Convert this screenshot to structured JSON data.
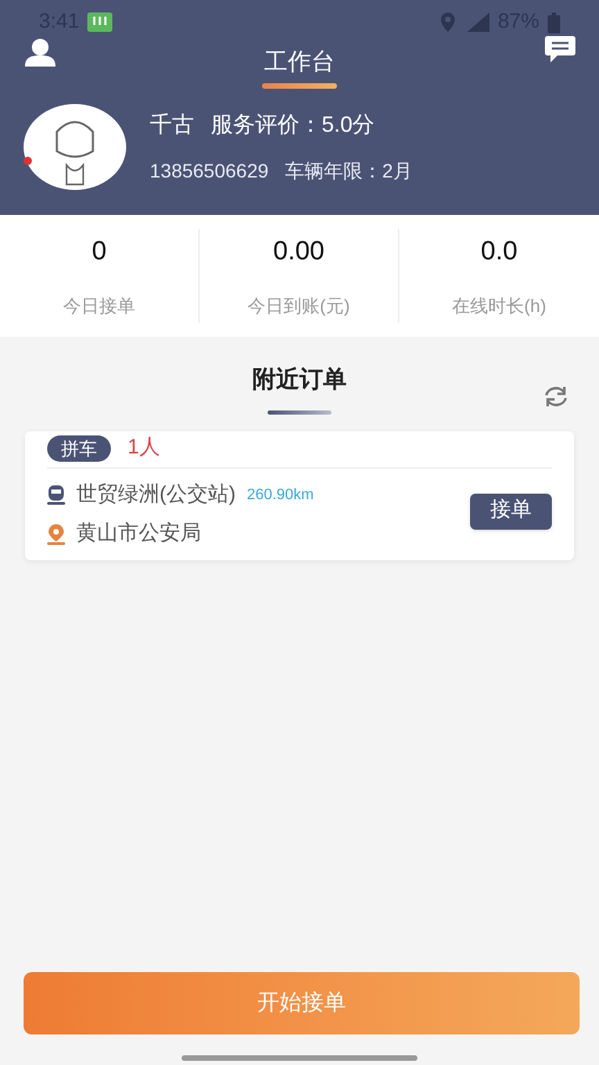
{
  "status_bar": {
    "time": "3:41",
    "battery": "87%"
  },
  "header": {
    "title": "工作台"
  },
  "profile": {
    "name": "千古",
    "rating": "服务评价：5.0分",
    "phone": "13856506629",
    "vehicle_age": "车辆年限：2月"
  },
  "stats": [
    {
      "value": "0",
      "label": "今日接单"
    },
    {
      "value": "0.00",
      "label": "今日到账(元)"
    },
    {
      "value": "0.0",
      "label": "在线时长(h)"
    }
  ],
  "nearby": {
    "title": "附近订单",
    "orders": [
      {
        "type": "拼车",
        "passengers": "1人",
        "from": "世贸绿洲(公交站)",
        "distance": "260.90km",
        "to": "黄山市公安局",
        "action": "接单"
      }
    ]
  },
  "start_button": "开始接单"
}
